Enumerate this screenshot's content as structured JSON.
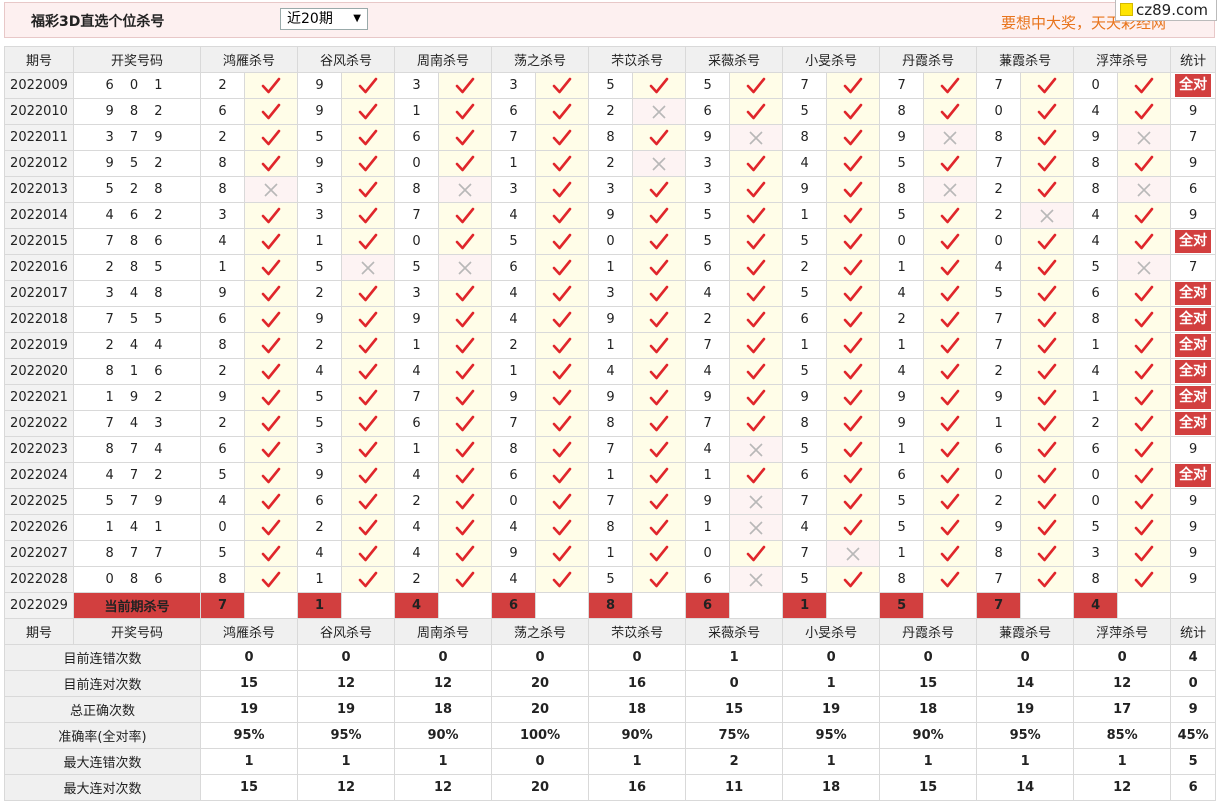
{
  "header": {
    "title": "福彩3D直选个位杀号",
    "select_value": "近20期",
    "slogan": "要想中大奖，天天彩经网",
    "site_badge": "cz89.com"
  },
  "columns": {
    "issue": "期号",
    "draw": "开奖号码",
    "experts": [
      "鸿雁杀号",
      "谷风杀号",
      "周南杀号",
      "荡之杀号",
      "芣苡杀号",
      "采薇杀号",
      "小旻杀号",
      "丹霞杀号",
      "蒹霞杀号",
      "浮萍杀号"
    ],
    "stat": "统计"
  },
  "rows": [
    {
      "issue": "2022009",
      "draw": "6 0 1",
      "kills": [
        "2",
        "9",
        "3",
        "3",
        "5",
        "5",
        "7",
        "7",
        "7",
        "0"
      ],
      "hits": [
        1,
        1,
        1,
        1,
        1,
        1,
        1,
        1,
        1,
        1
      ],
      "stat": "全对",
      "all": true
    },
    {
      "issue": "2022010",
      "draw": "9 8 2",
      "kills": [
        "6",
        "9",
        "1",
        "6",
        "2",
        "6",
        "5",
        "8",
        "0",
        "4"
      ],
      "hits": [
        1,
        1,
        1,
        1,
        0,
        1,
        1,
        1,
        1,
        1
      ],
      "stat": "9",
      "all": false
    },
    {
      "issue": "2022011",
      "draw": "3 7 9",
      "kills": [
        "2",
        "5",
        "6",
        "7",
        "8",
        "9",
        "8",
        "9",
        "8",
        "9"
      ],
      "hits": [
        1,
        1,
        1,
        1,
        1,
        0,
        1,
        0,
        1,
        0
      ],
      "stat": "7",
      "all": false
    },
    {
      "issue": "2022012",
      "draw": "9 5 2",
      "kills": [
        "8",
        "9",
        "0",
        "1",
        "2",
        "3",
        "4",
        "5",
        "7",
        "8"
      ],
      "hits": [
        1,
        1,
        1,
        1,
        0,
        1,
        1,
        1,
        1,
        1
      ],
      "stat": "9",
      "all": false
    },
    {
      "issue": "2022013",
      "draw": "5 2 8",
      "kills": [
        "8",
        "3",
        "8",
        "3",
        "3",
        "3",
        "9",
        "8",
        "2",
        "8"
      ],
      "hits": [
        0,
        1,
        0,
        1,
        1,
        1,
        1,
        0,
        1,
        0
      ],
      "stat": "6",
      "all": false
    },
    {
      "issue": "2022014",
      "draw": "4 6 2",
      "kills": [
        "3",
        "3",
        "7",
        "4",
        "9",
        "5",
        "1",
        "5",
        "2",
        "4"
      ],
      "hits": [
        1,
        1,
        1,
        1,
        1,
        1,
        1,
        1,
        0,
        1
      ],
      "stat": "9",
      "all": false
    },
    {
      "issue": "2022015",
      "draw": "7 8 6",
      "kills": [
        "4",
        "1",
        "0",
        "5",
        "0",
        "5",
        "5",
        "0",
        "0",
        "4"
      ],
      "hits": [
        1,
        1,
        1,
        1,
        1,
        1,
        1,
        1,
        1,
        1
      ],
      "stat": "全对",
      "all": true
    },
    {
      "issue": "2022016",
      "draw": "2 8 5",
      "kills": [
        "1",
        "5",
        "5",
        "6",
        "1",
        "6",
        "2",
        "1",
        "4",
        "5"
      ],
      "hits": [
        1,
        0,
        0,
        1,
        1,
        1,
        1,
        1,
        1,
        0
      ],
      "stat": "7",
      "all": false
    },
    {
      "issue": "2022017",
      "draw": "3 4 8",
      "kills": [
        "9",
        "2",
        "3",
        "4",
        "3",
        "4",
        "5",
        "4",
        "5",
        "6"
      ],
      "hits": [
        1,
        1,
        1,
        1,
        1,
        1,
        1,
        1,
        1,
        1
      ],
      "stat": "全对",
      "all": true
    },
    {
      "issue": "2022018",
      "draw": "7 5 5",
      "kills": [
        "6",
        "9",
        "9",
        "4",
        "9",
        "2",
        "6",
        "2",
        "7",
        "8"
      ],
      "hits": [
        1,
        1,
        1,
        1,
        1,
        1,
        1,
        1,
        1,
        1
      ],
      "stat": "全对",
      "all": true
    },
    {
      "issue": "2022019",
      "draw": "2 4 4",
      "kills": [
        "8",
        "2",
        "1",
        "2",
        "1",
        "7",
        "1",
        "1",
        "7",
        "1"
      ],
      "hits": [
        1,
        1,
        1,
        1,
        1,
        1,
        1,
        1,
        1,
        1
      ],
      "stat": "全对",
      "all": true
    },
    {
      "issue": "2022020",
      "draw": "8 1 6",
      "kills": [
        "2",
        "4",
        "4",
        "1",
        "4",
        "4",
        "5",
        "4",
        "2",
        "4"
      ],
      "hits": [
        1,
        1,
        1,
        1,
        1,
        1,
        1,
        1,
        1,
        1
      ],
      "stat": "全对",
      "all": true
    },
    {
      "issue": "2022021",
      "draw": "1 9 2",
      "kills": [
        "9",
        "5",
        "7",
        "9",
        "9",
        "9",
        "9",
        "9",
        "9",
        "1"
      ],
      "hits": [
        1,
        1,
        1,
        1,
        1,
        1,
        1,
        1,
        1,
        1
      ],
      "stat": "全对",
      "all": true
    },
    {
      "issue": "2022022",
      "draw": "7 4 3",
      "kills": [
        "2",
        "5",
        "6",
        "7",
        "8",
        "7",
        "8",
        "9",
        "1",
        "2"
      ],
      "hits": [
        1,
        1,
        1,
        1,
        1,
        1,
        1,
        1,
        1,
        1
      ],
      "stat": "全对",
      "all": true
    },
    {
      "issue": "2022023",
      "draw": "8 7 4",
      "kills": [
        "6",
        "3",
        "1",
        "8",
        "7",
        "4",
        "5",
        "1",
        "6",
        "6"
      ],
      "hits": [
        1,
        1,
        1,
        1,
        1,
        0,
        1,
        1,
        1,
        1
      ],
      "stat": "9",
      "all": false
    },
    {
      "issue": "2022024",
      "draw": "4 7 2",
      "kills": [
        "5",
        "9",
        "4",
        "6",
        "1",
        "1",
        "6",
        "6",
        "0",
        "0"
      ],
      "hits": [
        1,
        1,
        1,
        1,
        1,
        1,
        1,
        1,
        1,
        1
      ],
      "stat": "全对",
      "all": true
    },
    {
      "issue": "2022025",
      "draw": "5 7 9",
      "kills": [
        "4",
        "6",
        "2",
        "0",
        "7",
        "9",
        "7",
        "5",
        "2",
        "0"
      ],
      "hits": [
        1,
        1,
        1,
        1,
        1,
        0,
        1,
        1,
        1,
        1
      ],
      "stat": "9",
      "all": false
    },
    {
      "issue": "2022026",
      "draw": "1 4 1",
      "kills": [
        "0",
        "2",
        "4",
        "4",
        "8",
        "1",
        "4",
        "5",
        "9",
        "5"
      ],
      "hits": [
        1,
        1,
        1,
        1,
        1,
        0,
        1,
        1,
        1,
        1
      ],
      "stat": "9",
      "all": false
    },
    {
      "issue": "2022027",
      "draw": "8 7 7",
      "kills": [
        "5",
        "4",
        "4",
        "9",
        "1",
        "0",
        "7",
        "1",
        "8",
        "3"
      ],
      "hits": [
        1,
        1,
        1,
        1,
        1,
        1,
        0,
        1,
        1,
        1
      ],
      "stat": "9",
      "all": false
    },
    {
      "issue": "2022028",
      "draw": "0 8 6",
      "kills": [
        "8",
        "1",
        "2",
        "4",
        "5",
        "6",
        "5",
        "8",
        "7",
        "8"
      ],
      "hits": [
        1,
        1,
        1,
        1,
        1,
        0,
        1,
        1,
        1,
        1
      ],
      "stat": "9",
      "all": false
    }
  ],
  "current": {
    "issue": "2022029",
    "label": "当前期杀号",
    "kills": [
      "7",
      "1",
      "4",
      "6",
      "8",
      "6",
      "1",
      "5",
      "7",
      "4"
    ]
  },
  "stats": [
    {
      "label": "目前连错次数",
      "values": [
        "0",
        "0",
        "0",
        "0",
        "0",
        "1",
        "0",
        "0",
        "0",
        "0"
      ],
      "stat": "4",
      "red": false
    },
    {
      "label": "目前连对次数",
      "values": [
        "15",
        "12",
        "12",
        "20",
        "16",
        "0",
        "1",
        "15",
        "14",
        "12"
      ],
      "stat": "0",
      "red": false
    },
    {
      "label": "总正确次数",
      "values": [
        "19",
        "19",
        "18",
        "20",
        "18",
        "15",
        "19",
        "18",
        "19",
        "17"
      ],
      "stat": "9",
      "red": false
    },
    {
      "label": "准确率(全对率)",
      "values": [
        "95%",
        "95%",
        "90%",
        "100%",
        "90%",
        "75%",
        "95%",
        "90%",
        "95%",
        "85%"
      ],
      "stat": "45%",
      "red": true
    },
    {
      "label": "最大连错次数",
      "values": [
        "1",
        "1",
        "1",
        "0",
        "1",
        "2",
        "1",
        "1",
        "1",
        "1"
      ],
      "stat": "5",
      "red": false
    },
    {
      "label": "最大连对次数",
      "values": [
        "15",
        "12",
        "12",
        "20",
        "16",
        "11",
        "18",
        "15",
        "14",
        "12"
      ],
      "stat": "6",
      "red": false
    }
  ],
  "colors": {
    "check": "#e0262b",
    "cross": "#b8b8b8",
    "badge": "#d23f3f",
    "blue": "#1a35b0"
  }
}
